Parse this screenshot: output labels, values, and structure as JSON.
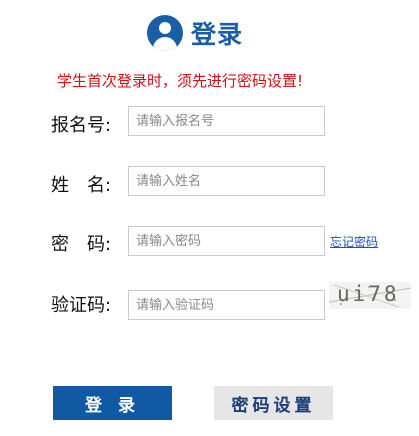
{
  "header": {
    "title": "登录",
    "icon": "user-icon",
    "color": "#1a5fa6"
  },
  "notice": "学生首次登录时，须先进行密码设置!",
  "form": {
    "exam_no": {
      "label": "报名号:",
      "placeholder": "请输入报名号",
      "value": ""
    },
    "name": {
      "label": "姓　名:",
      "placeholder": "请输入姓名",
      "value": ""
    },
    "password": {
      "label": "密　码:",
      "placeholder": "请输入密码",
      "value": "",
      "forgot_link": "忘记密码"
    },
    "captcha": {
      "label": "验证码:",
      "placeholder": "请输入验证码",
      "value": "",
      "image_text": "ui78"
    }
  },
  "buttons": {
    "login": "登 录",
    "set_password": "密码设置"
  },
  "colors": {
    "primary": "#0f5aa3",
    "notice": "#cc1111",
    "link": "#1f4fbf",
    "secondary_bg": "#e6e6e6"
  }
}
